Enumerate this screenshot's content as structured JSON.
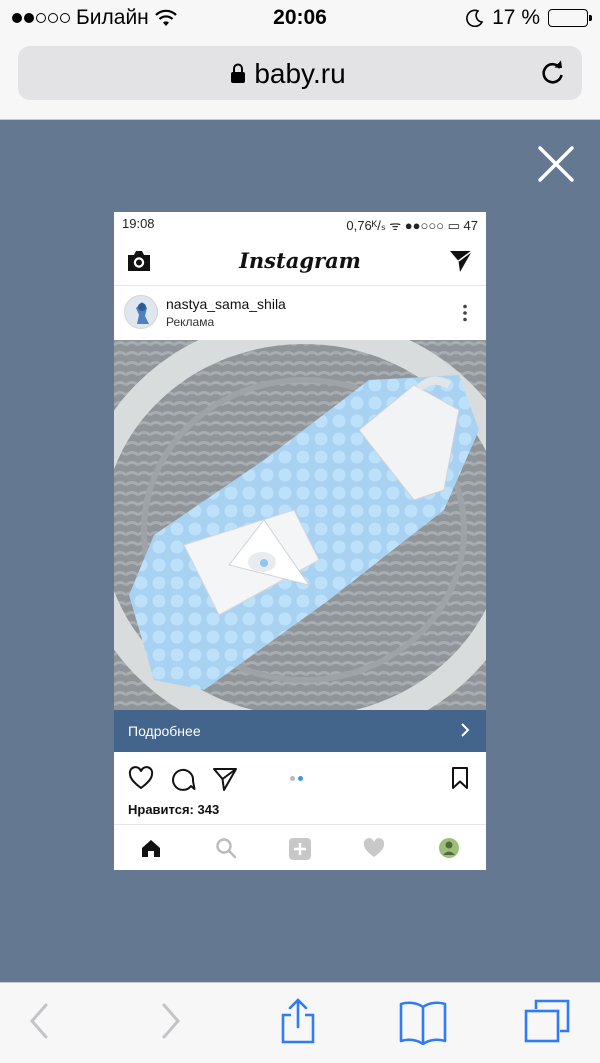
{
  "status_bar": {
    "carrier": "Билайн",
    "time": "20:06",
    "battery_percent": "17 %",
    "battery_level": 0.17,
    "signal_bars_filled": 2,
    "signal_bars_total": 5
  },
  "safari": {
    "url_domain": "baby.ru"
  },
  "instagram_screenshot": {
    "status_time": "19:08",
    "status_right": "0,76ᴷ/ₛ ᯤ ●●○○○ ▭ 47",
    "app_logo": "Instagram",
    "username": "nastya_sama_shila",
    "sponsored_label": "Реклама",
    "cta_label": "Подробнее",
    "likes_text": "Нравится: 343",
    "carousel_dots_total": 2,
    "carousel_dots_active": 2
  },
  "colors": {
    "backdrop": "#647892",
    "ig_cta": "#43648b",
    "safari_blue": "#2f7cf6",
    "battery_red": "#e8241c"
  }
}
